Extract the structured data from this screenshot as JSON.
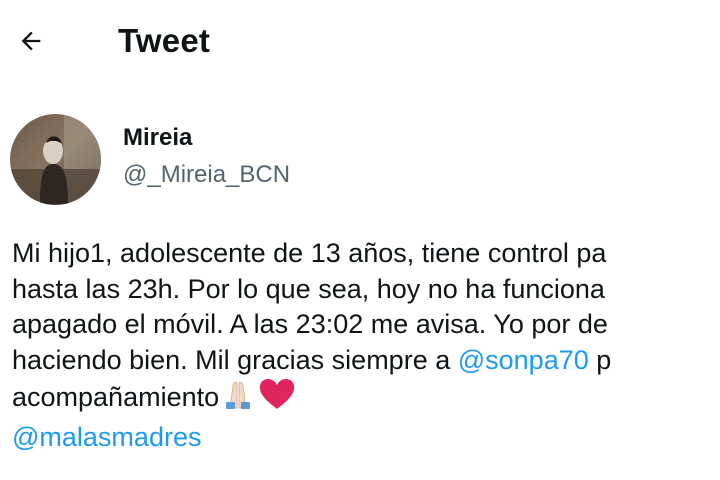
{
  "header": {
    "title": "Tweet",
    "back_icon": "arrow-left-icon"
  },
  "author": {
    "display_name": "Mireia",
    "handle": "@_Mireia_BCN",
    "avatar_icon": "profile-photo"
  },
  "tweet": {
    "line1": "Mi hijo1, adolescente de 13 años, tiene control pa",
    "line2": "hasta las 23h. Por lo que sea, hoy no ha funciona",
    "line3": "apagado el móvil. A las 23:02 me avisa. Yo por de",
    "line4_text": "haciendo bien. Mil gracias siempre a ",
    "line4_mention": "@sonpa70",
    "line4_after": " p",
    "line5_text": "acompañamiento",
    "emojis": [
      "folded-hands-icon",
      "red-heart-icon"
    ],
    "line6_mention": "@malasmadres"
  },
  "colors": {
    "text": "#0f1419",
    "secondary": "#536471",
    "link": "#1d9bf0",
    "heart": "#e0245e"
  }
}
